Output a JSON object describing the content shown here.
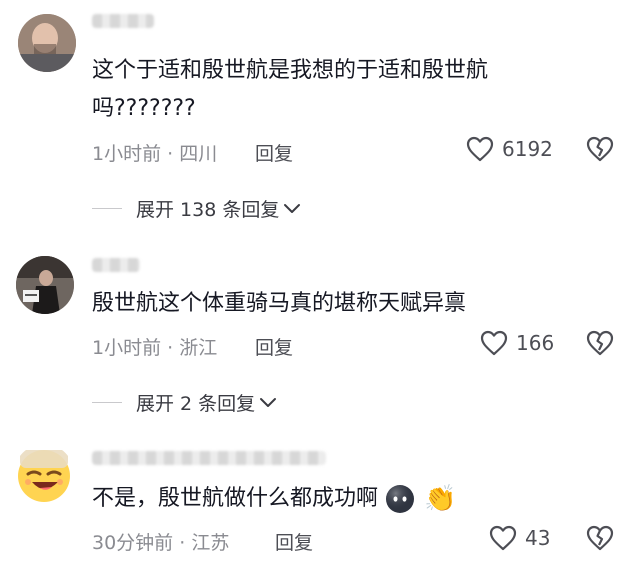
{
  "comments": [
    {
      "text_line1": "这个于适和殷世航是我想的于适和殷世航",
      "text_line2": "吗???????",
      "time": "1小时前",
      "location": "四川",
      "reply_label": "回复",
      "likes": "6192",
      "expand_label": "展开 138 条回复"
    },
    {
      "text_line1": "殷世航这个体重骑马真的堪称天赋异禀",
      "time": "1小时前",
      "location": "浙江",
      "reply_label": "回复",
      "likes": "166",
      "expand_label": "展开 2 条回复"
    },
    {
      "text_line1": "不是，殷世航做什么都成功啊",
      "emoji_1": "dark-face-emoji",
      "emoji_2": "👏",
      "time": "30分钟前",
      "location": "江苏",
      "reply_label": "回复",
      "likes": "43"
    }
  ],
  "separator": " · ",
  "icons": {
    "like": "heart-outline-icon",
    "dislike": "broken-heart-icon",
    "expand": "chevron-down-icon"
  }
}
